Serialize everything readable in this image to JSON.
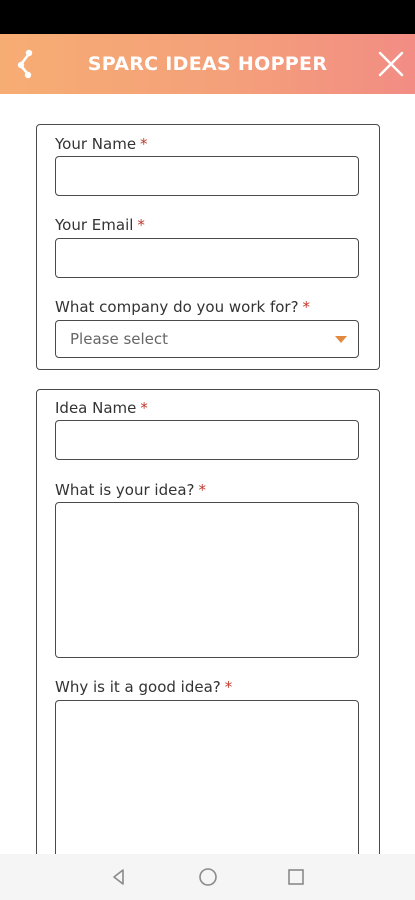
{
  "header": {
    "title": "SPARC IDEAS HOPPER",
    "logo_icon": "sparc-logo-icon",
    "close_icon": "close-icon",
    "gradient_start": "#f6ad73",
    "gradient_end": "#f28c84"
  },
  "form": {
    "section_contact": {
      "name_label": "Your Name",
      "name_value": "",
      "email_label": "Your Email",
      "email_value": "",
      "company_label": "What company do you work for?",
      "company_selected": "Please select"
    },
    "section_idea": {
      "idea_name_label": "Idea Name",
      "idea_name_value": "",
      "idea_label": "What is your idea?",
      "idea_value": "",
      "why_label": "Why is it a good idea?",
      "why_value": ""
    },
    "required_marker": "*",
    "required_color": "#c0392b",
    "accent_color": "#e0893f"
  },
  "navbar": {
    "back_icon": "back-triangle-icon",
    "home_icon": "home-circle-icon",
    "recents_icon": "recents-square-icon"
  }
}
